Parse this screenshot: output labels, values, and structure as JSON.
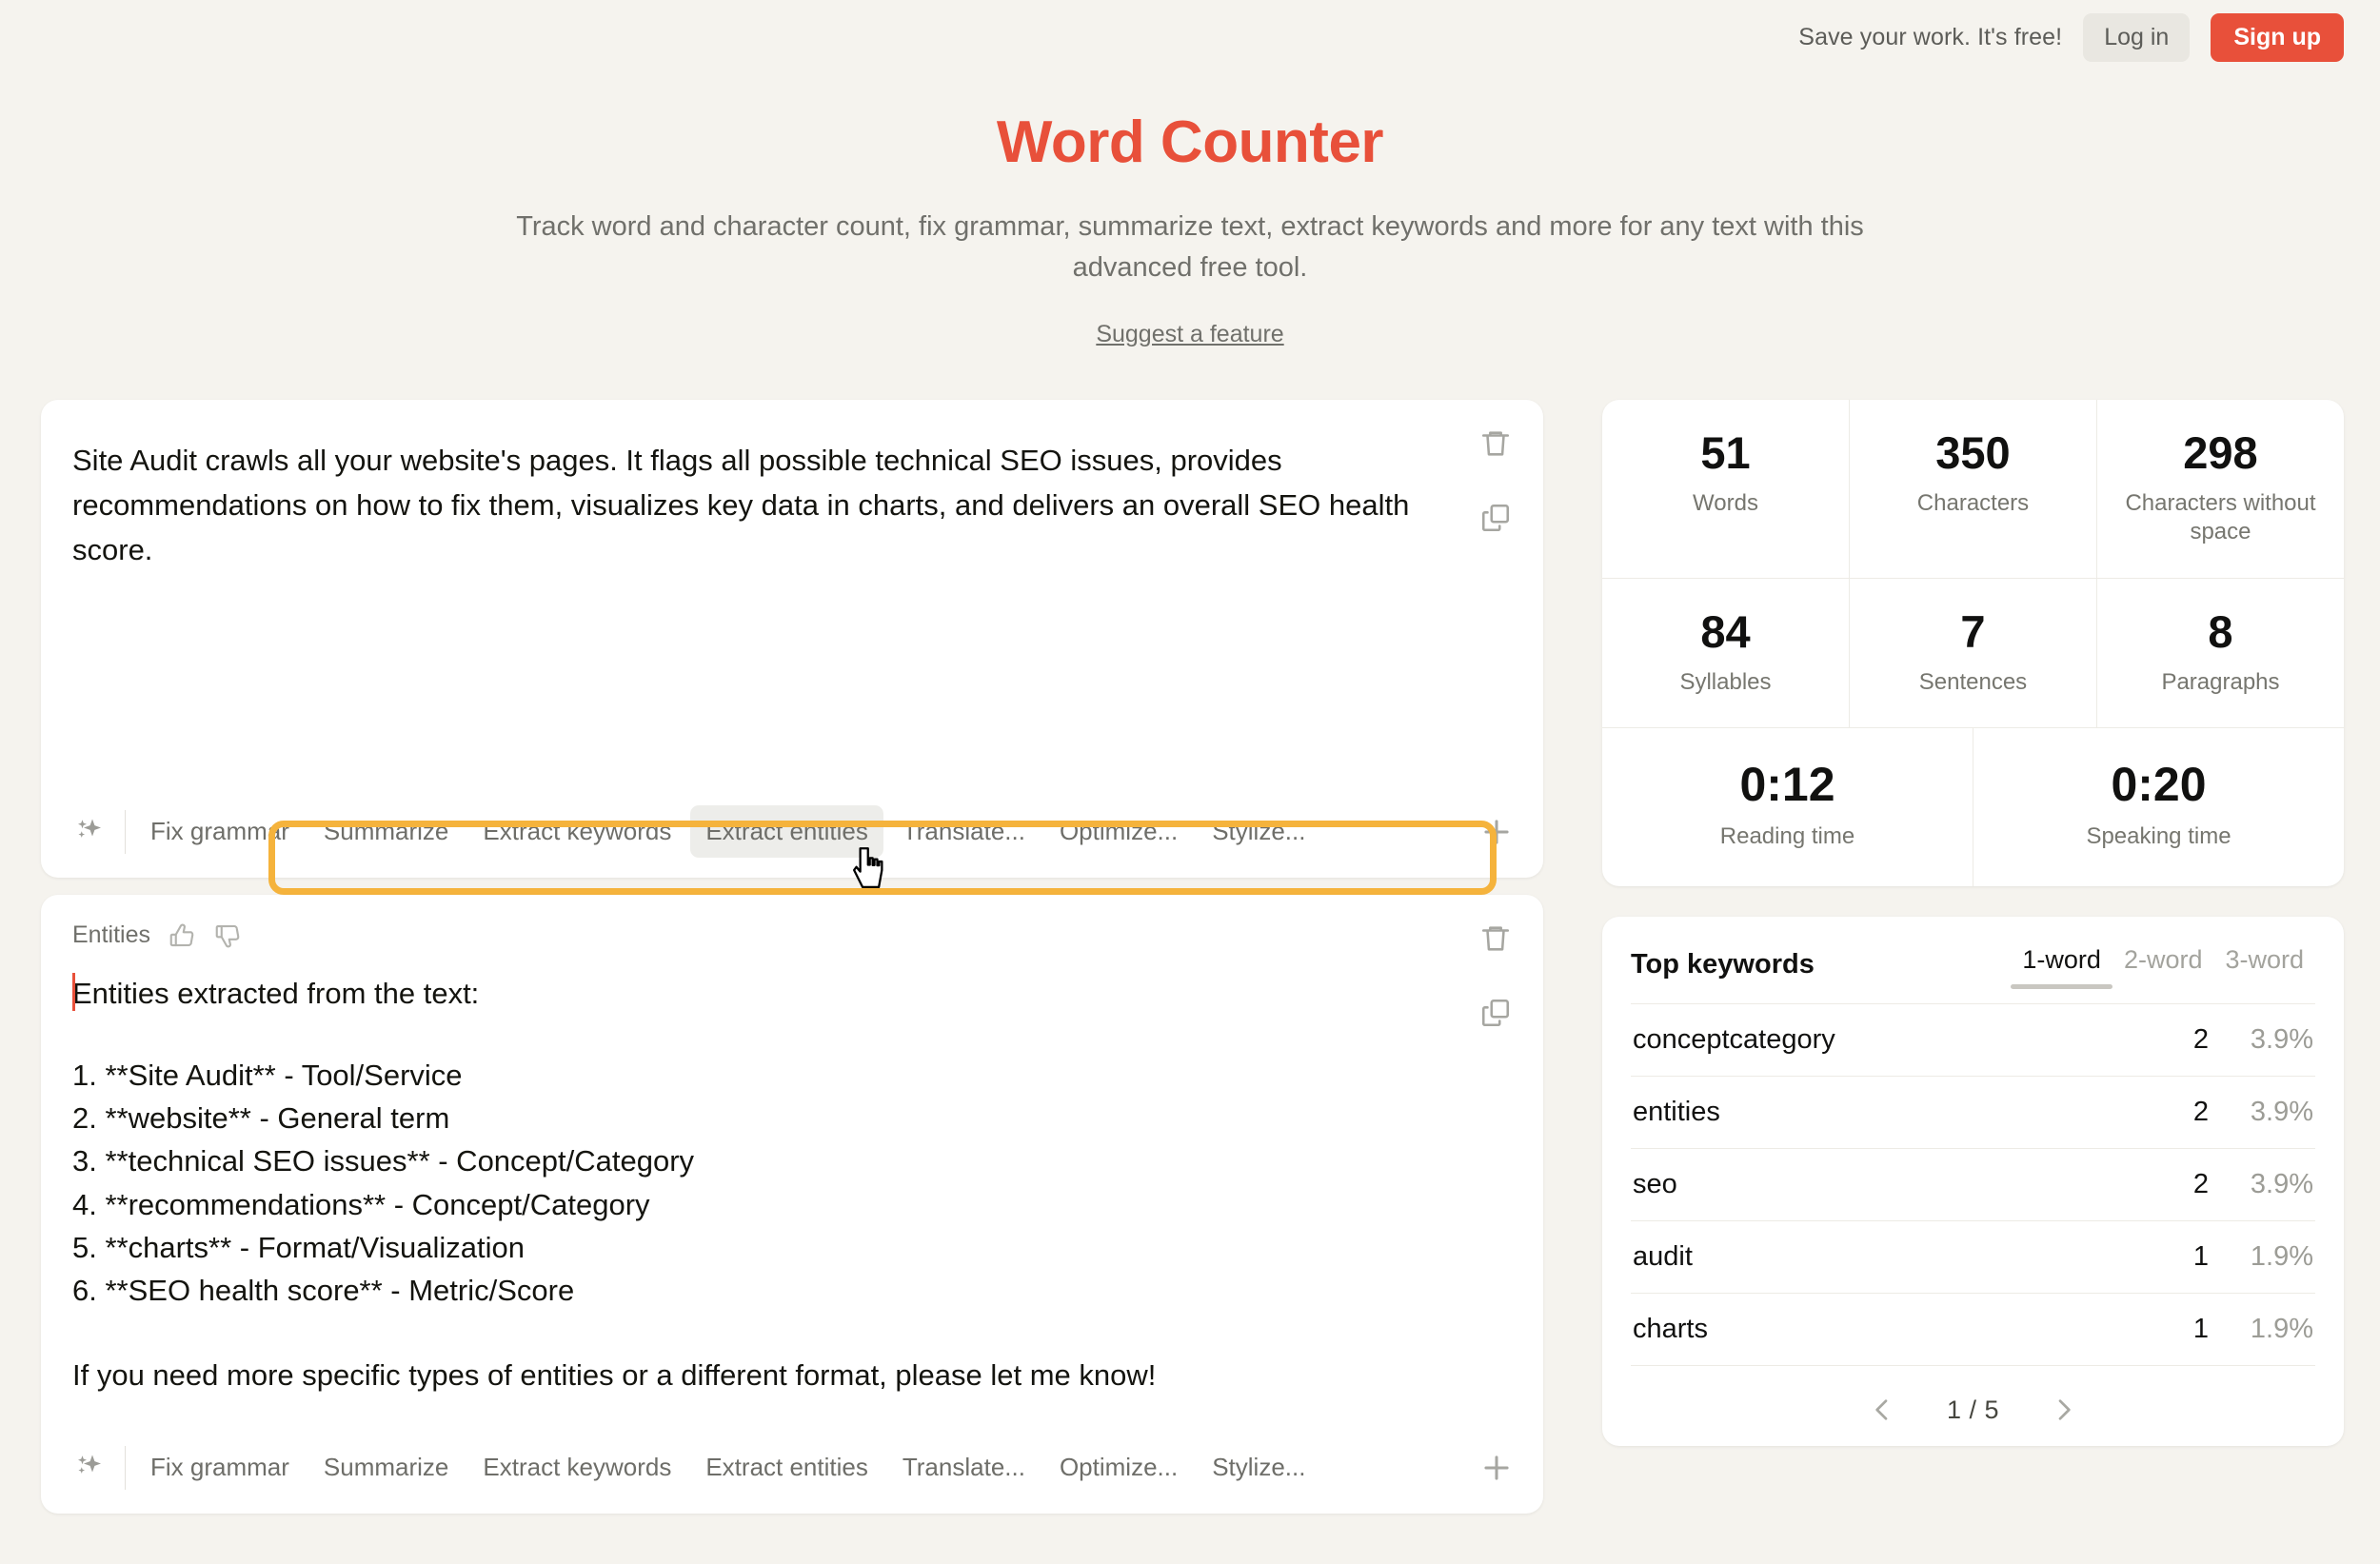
{
  "topbar": {
    "note": "Save your work. It's free!",
    "login_label": "Log in",
    "signup_label": "Sign up"
  },
  "hero": {
    "title": "Word Counter",
    "subtitle": "Track word and character count, fix grammar, summarize text, extract keywords and more for any text with this advanced free tool.",
    "link": "Suggest a feature"
  },
  "editor": {
    "text": "Site Audit crawls all your website's pages. It flags all possible technical SEO issues, provides recommendations on how to fix them, visualizes key data in charts, and delivers an overall SEO health score.",
    "delete_icon": "trash-icon",
    "copy_icon": "copy-icon"
  },
  "toolbar": {
    "sparkle_icon": "sparkles-icon",
    "plus_icon": "plus-icon",
    "actions": [
      "Fix grammar",
      "Summarize",
      "Extract keywords",
      "Extract entities",
      "Translate...",
      "Optimize...",
      "Stylize..."
    ],
    "hovered_action": "Extract entities",
    "highlight_color": "#F5B33C"
  },
  "output": {
    "label": "Entities",
    "thumbs_up_icon": "thumbs-up-icon",
    "thumbs_down_icon": "thumbs-down-icon",
    "intro": "Entities extracted from the text:",
    "items": [
      "1. **Site Audit** - Tool/Service",
      "2. **website** - General term",
      "3. **technical SEO issues** - Concept/Category",
      "4. **recommendations** - Concept/Category",
      "5. **charts** - Format/Visualization",
      "6. **SEO health score** - Metric/Score"
    ],
    "footer": "If you need more specific types of entities or a different format, please let me know!"
  },
  "stats": {
    "rows": [
      [
        {
          "value": "51",
          "label": "Words"
        },
        {
          "value": "350",
          "label": "Characters"
        },
        {
          "value": "298",
          "label": "Characters without space"
        }
      ],
      [
        {
          "value": "84",
          "label": "Syllables"
        },
        {
          "value": "7",
          "label": "Sentences"
        },
        {
          "value": "8",
          "label": "Paragraphs"
        }
      ],
      [
        {
          "value": "0:12",
          "label": "Reading time"
        },
        {
          "value": "0:20",
          "label": "Speaking time"
        }
      ]
    ]
  },
  "keywords": {
    "title": "Top keywords",
    "tabs": [
      {
        "label": "1-word",
        "active": true
      },
      {
        "label": "2-word",
        "active": false
      },
      {
        "label": "3-word",
        "active": false
      }
    ],
    "rows": [
      {
        "word": "conceptcategory",
        "count": "2",
        "pct": "3.9%"
      },
      {
        "word": "entities",
        "count": "2",
        "pct": "3.9%"
      },
      {
        "word": "seo",
        "count": "2",
        "pct": "3.9%"
      },
      {
        "word": "audit",
        "count": "1",
        "pct": "1.9%"
      },
      {
        "word": "charts",
        "count": "1",
        "pct": "1.9%"
      }
    ],
    "pager": {
      "prev_icon": "chevron-left-icon",
      "label": "1 / 5",
      "next_icon": "chevron-right-icon"
    }
  },
  "theme": {
    "background": "#F5F3EE",
    "accent": "#E8503A",
    "highlight": "#F5B33C"
  }
}
